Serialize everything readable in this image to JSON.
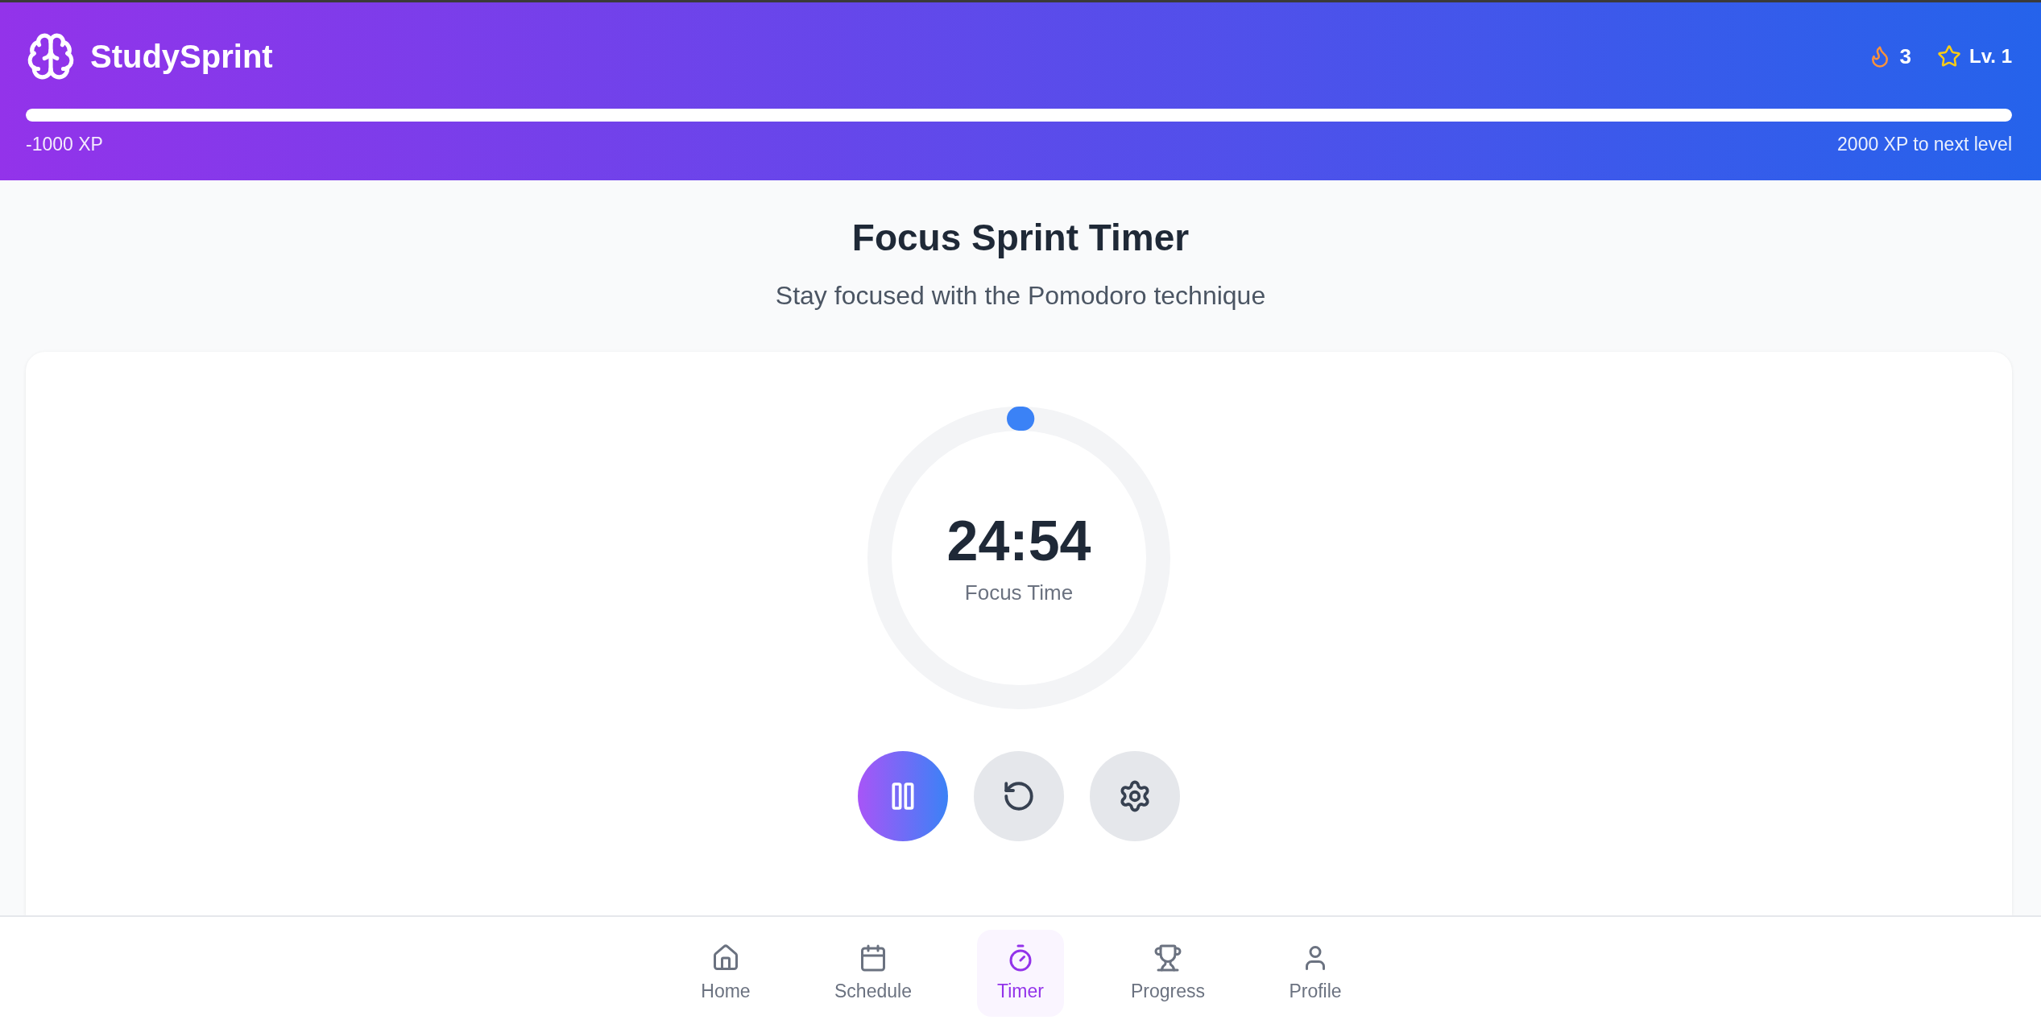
{
  "header": {
    "app_name": "StudySprint",
    "streak": "3",
    "level_label": "Lv. 1",
    "xp_progress": {
      "level": 1
    },
    "xp_current": "-1000 XP",
    "xp_to_next": "2000 XP to next level"
  },
  "page": {
    "title": "Focus Sprint Timer",
    "subtitle": "Stay focused with the Pomodoro technique"
  },
  "timer": {
    "time": "24:54",
    "mode_label": "Focus Time",
    "running": true,
    "progress": {
      "level": 0.004
    }
  },
  "nav": [
    {
      "kind": "home",
      "label": "Home",
      "selected": false
    },
    {
      "kind": "schedule",
      "label": "Schedule",
      "selected": false
    },
    {
      "kind": "timer",
      "label": "Timer",
      "selected": true
    },
    {
      "kind": "progress",
      "label": "Progress",
      "selected": false
    },
    {
      "kind": "profile",
      "label": "Profile",
      "selected": false
    }
  ]
}
